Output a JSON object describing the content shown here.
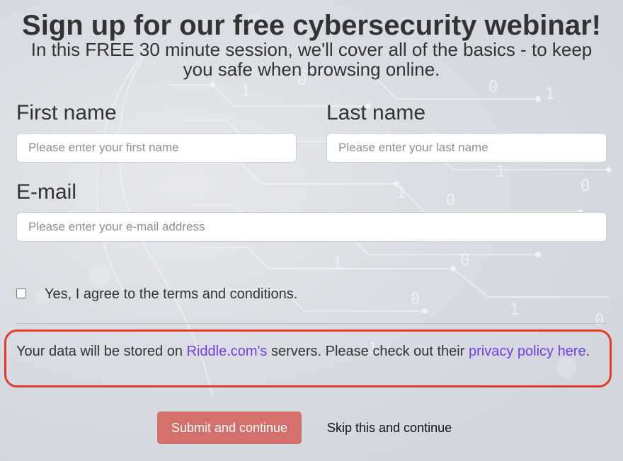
{
  "header": {
    "title": "Sign up for our free cybersecurity webinar!",
    "subtitle": "In this FREE 30 minute session, we'll cover all of the basics - to keep you safe when browsing online."
  },
  "form": {
    "first_name": {
      "label": "First name",
      "placeholder": "Please enter your first name",
      "value": ""
    },
    "last_name": {
      "label": "Last name",
      "placeholder": "Please enter your last name",
      "value": ""
    },
    "email": {
      "label": "E-mail",
      "placeholder": "Please enter your e-mail address",
      "value": ""
    },
    "terms": {
      "label": "Yes, I agree to the terms and conditions.",
      "checked": false
    }
  },
  "notice": {
    "prefix": "Your data will be stored on ",
    "riddle_link": "Riddle.com's",
    "middle": " servers. Please check out their ",
    "privacy_link": "privacy policy here",
    "suffix": "."
  },
  "actions": {
    "submit_label": "Submit and continue",
    "skip_label": "Skip this and continue"
  },
  "colors": {
    "submit_bg": "#d4706b",
    "link": "#6f3fe8",
    "highlight_border": "#e23b26"
  }
}
